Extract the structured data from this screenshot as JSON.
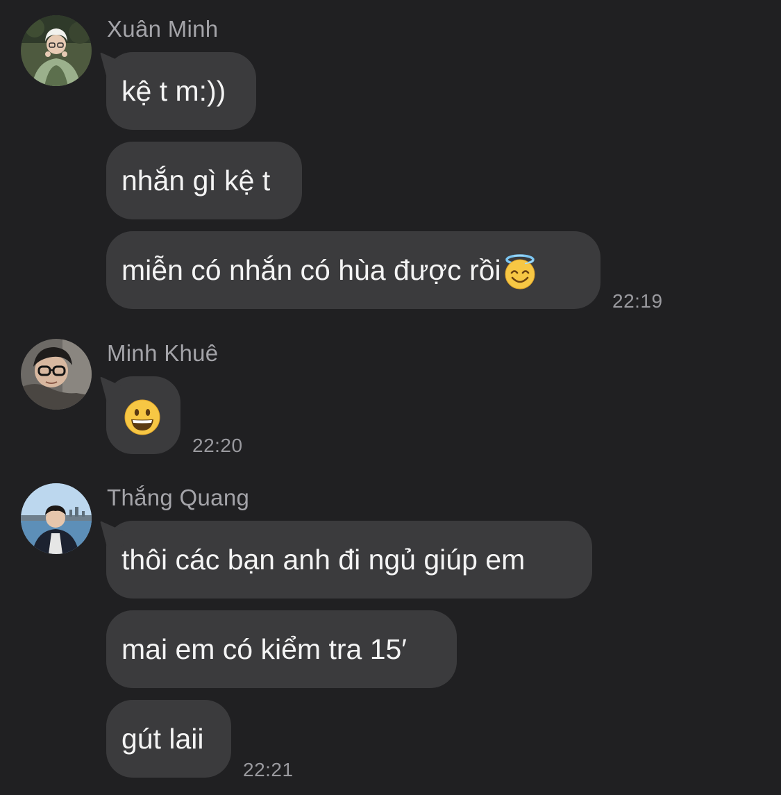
{
  "chat": {
    "groups": [
      {
        "sender": "Xuân Minh",
        "avatar_icon": "avatar-photo-girl-glasses-icon",
        "messages": [
          "kệ t m:))",
          "nhắn gì kệ t",
          "miễn có nhắn có hùa được rồi"
        ],
        "last_message_emoji": "smiling-face-with-halo-icon",
        "time": "22:19"
      },
      {
        "sender": "Minh Khuê",
        "avatar_icon": "avatar-photo-boy-glasses-icon",
        "messages": [],
        "emoji_message": "grinning-face-icon",
        "time": "22:20"
      },
      {
        "sender": "Thắng Quang",
        "avatar_icon": "avatar-photo-boy-river-icon",
        "messages": [
          "thôi các bạn anh đi ngủ giúp em",
          "mai em có kiểm tra 15′",
          "gút laii"
        ],
        "time": "22:21"
      }
    ]
  },
  "colors": {
    "background": "#202022",
    "bubble": "#3b3b3d",
    "sender_text": "#a4a4a9",
    "message_text": "#f4f4f4",
    "time_text": "#9a9a9f"
  }
}
